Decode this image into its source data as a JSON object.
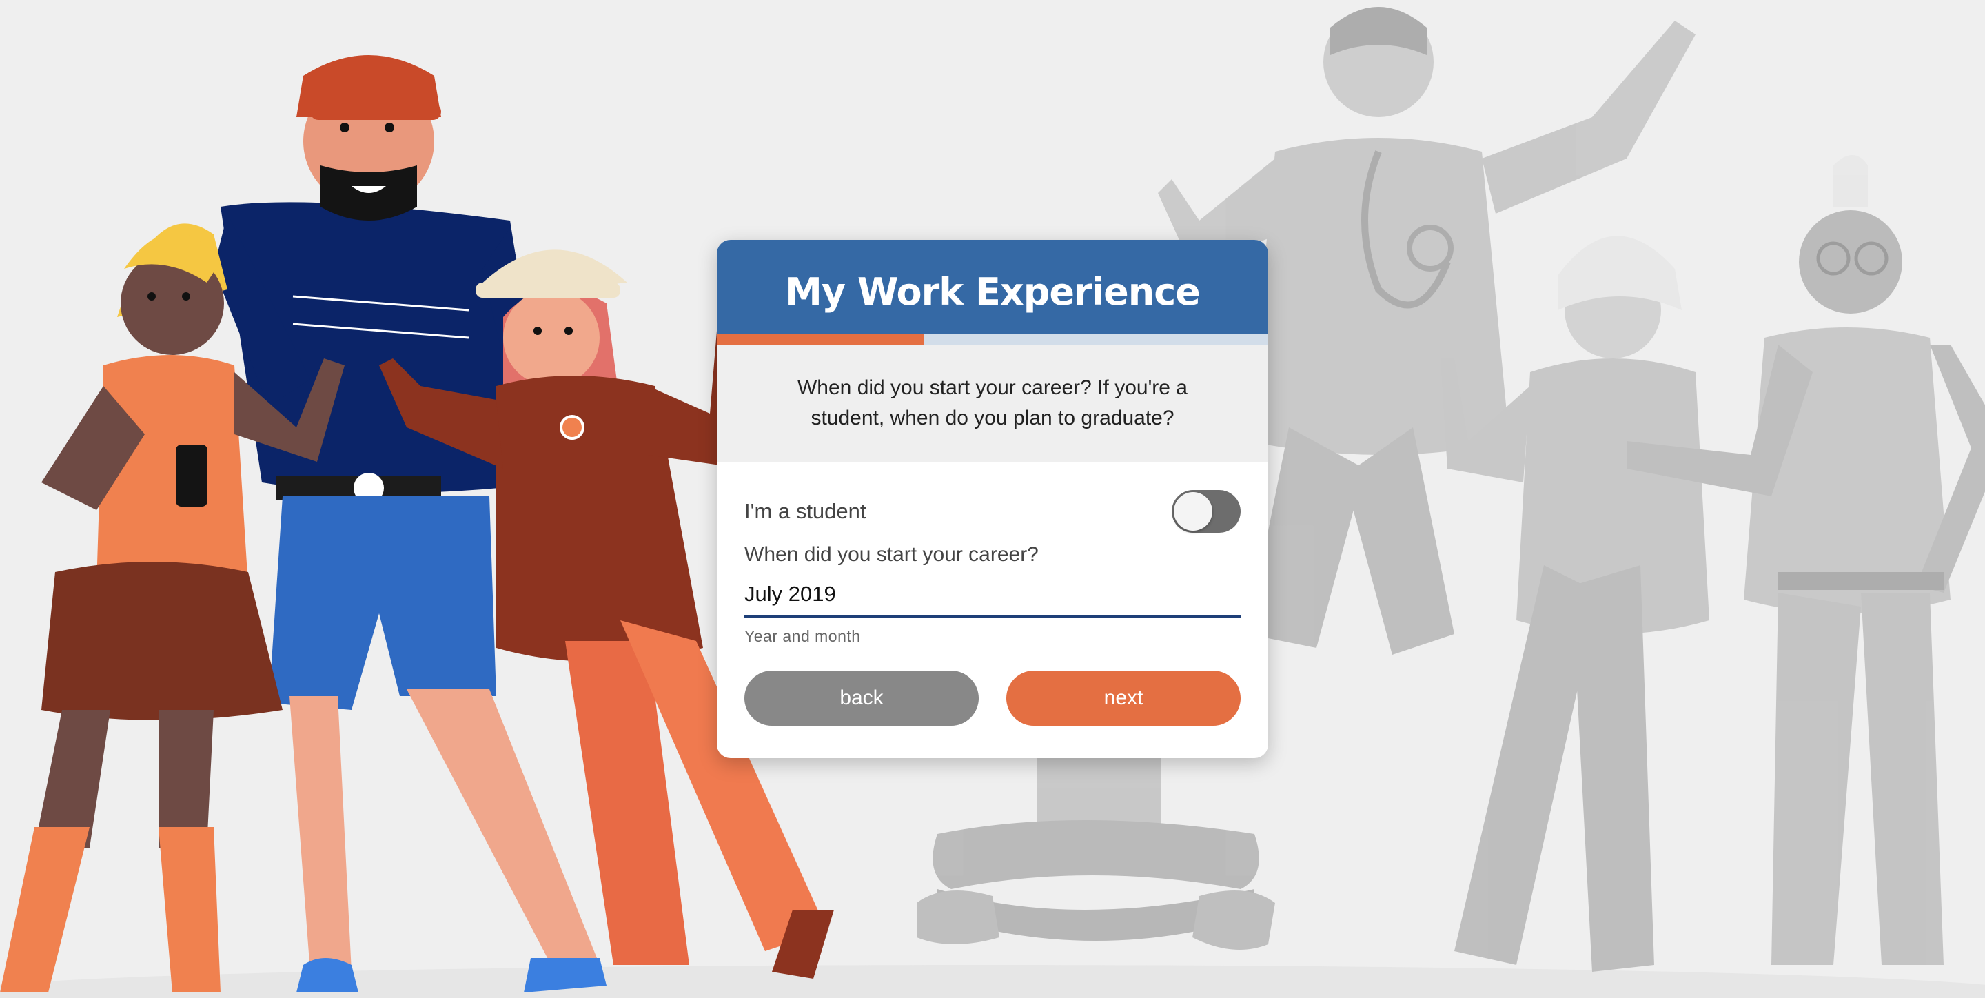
{
  "card": {
    "title": "My Work Experience",
    "progress_fraction": 0.375,
    "question": "When did you start your career? If you're a student, when do you plan to graduate?",
    "student_toggle": {
      "label": "I'm a student",
      "checked": false
    },
    "career_start": {
      "label": "When did you start your career?",
      "value": "July 2019",
      "helper": "Year and month"
    },
    "buttons": {
      "back_label": "back",
      "next_label": "next"
    }
  },
  "colors": {
    "header": "#3569a5",
    "accent": "#e46f42",
    "progress_track": "#d2dde9",
    "back_button": "#888888",
    "input_underline": "#1e3f78",
    "background": "#efefef"
  }
}
